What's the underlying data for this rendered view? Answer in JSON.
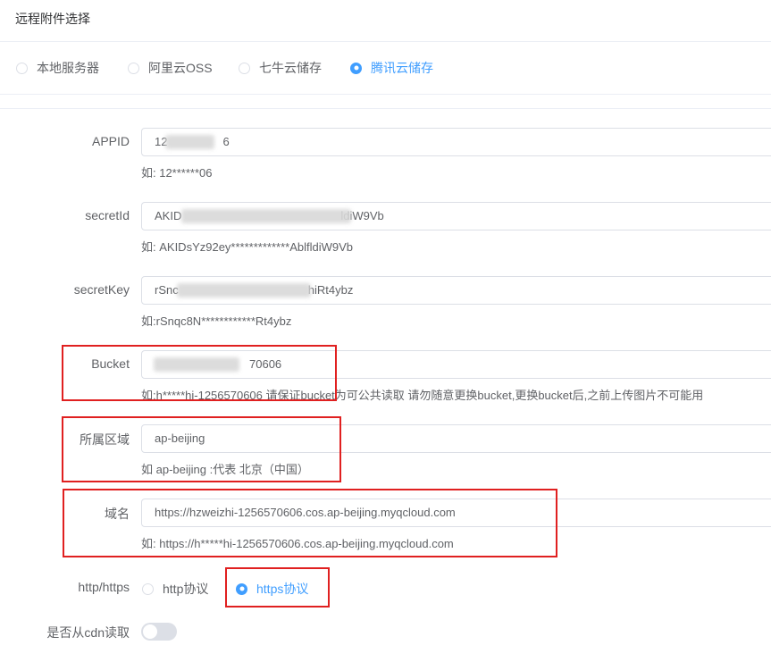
{
  "header": {
    "title": "远程附件选择"
  },
  "storage_options": [
    {
      "label": "本地服务器",
      "checked": false
    },
    {
      "label": "阿里云OSS",
      "checked": false
    },
    {
      "label": "七牛云储存",
      "checked": false
    },
    {
      "label": "腾讯云储存",
      "checked": true
    }
  ],
  "form": {
    "appid": {
      "label": "APPID",
      "value_start": "12",
      "value_end": "6",
      "hint": "如: 12******06"
    },
    "secretId": {
      "label": "secretId",
      "value_start": "AKID",
      "value_end": "ldiW9Vb",
      "hint": "如:  AKIDsYz92ey*************AblfldiW9Vb"
    },
    "secretKey": {
      "label": "secretKey",
      "value_start": "rSnc",
      "value_end": "hiRt4ybz",
      "hint": "如:rSnqc8N************Rt4ybz"
    },
    "bucket": {
      "label": "Bucket",
      "value_end": "70606",
      "hint": "如:h*****hi-1256570606 请保证bucket为可公共读取 请勿随意更换bucket,更换bucket后,之前上传图片不可能用"
    },
    "region": {
      "label": "所属区域",
      "value": "ap-beijing",
      "hint": "如 ap-beijing :代表 北京（中国）"
    },
    "domain": {
      "label": "域名",
      "value": "https://hzweizhi-1256570606.cos.ap-beijing.myqcloud.com",
      "hint": "如: https://h*****hi-1256570606.cos.ap-beijing.myqcloud.com"
    },
    "protocol": {
      "label": "http/https",
      "options": [
        {
          "label": "http协议",
          "checked": false
        },
        {
          "label": "https协议",
          "checked": true
        }
      ]
    },
    "cdn": {
      "label": "是否从cdn读取",
      "enabled": false
    }
  },
  "colors": {
    "accent": "#409eff",
    "highlight": "#e02020"
  }
}
